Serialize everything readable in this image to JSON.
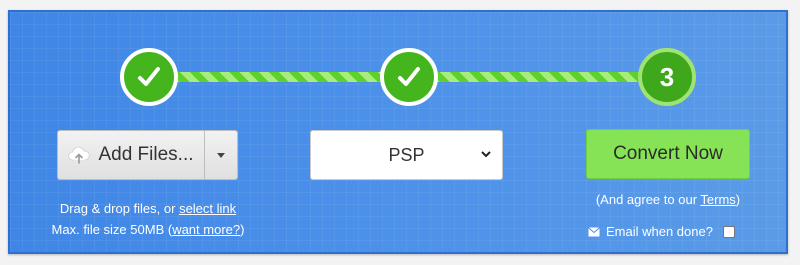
{
  "steps": [
    {
      "state": "done",
      "label": ""
    },
    {
      "state": "done",
      "label": ""
    },
    {
      "state": "current",
      "label": "3"
    }
  ],
  "add_files": {
    "label": "Add Files...",
    "icon": "cloud-upload-icon",
    "dropdown_icon": "caret-down-icon"
  },
  "help": {
    "line1_prefix": "Drag & drop files, or ",
    "line1_link": "select link",
    "line2_prefix": "Max. file size 50MB (",
    "line2_link": "want more?",
    "line2_suffix": ")"
  },
  "format_select": {
    "value": "PSP"
  },
  "convert": {
    "label": "Convert Now"
  },
  "agree": {
    "prefix": "(And agree to our ",
    "link": "Terms",
    "suffix": ")"
  },
  "email": {
    "label": "Email when done?",
    "checked": false,
    "icon": "envelope-icon"
  },
  "colors": {
    "panel": "#4b90ea",
    "step_done": "#44b51d",
    "convert_bg": "#86e356"
  }
}
